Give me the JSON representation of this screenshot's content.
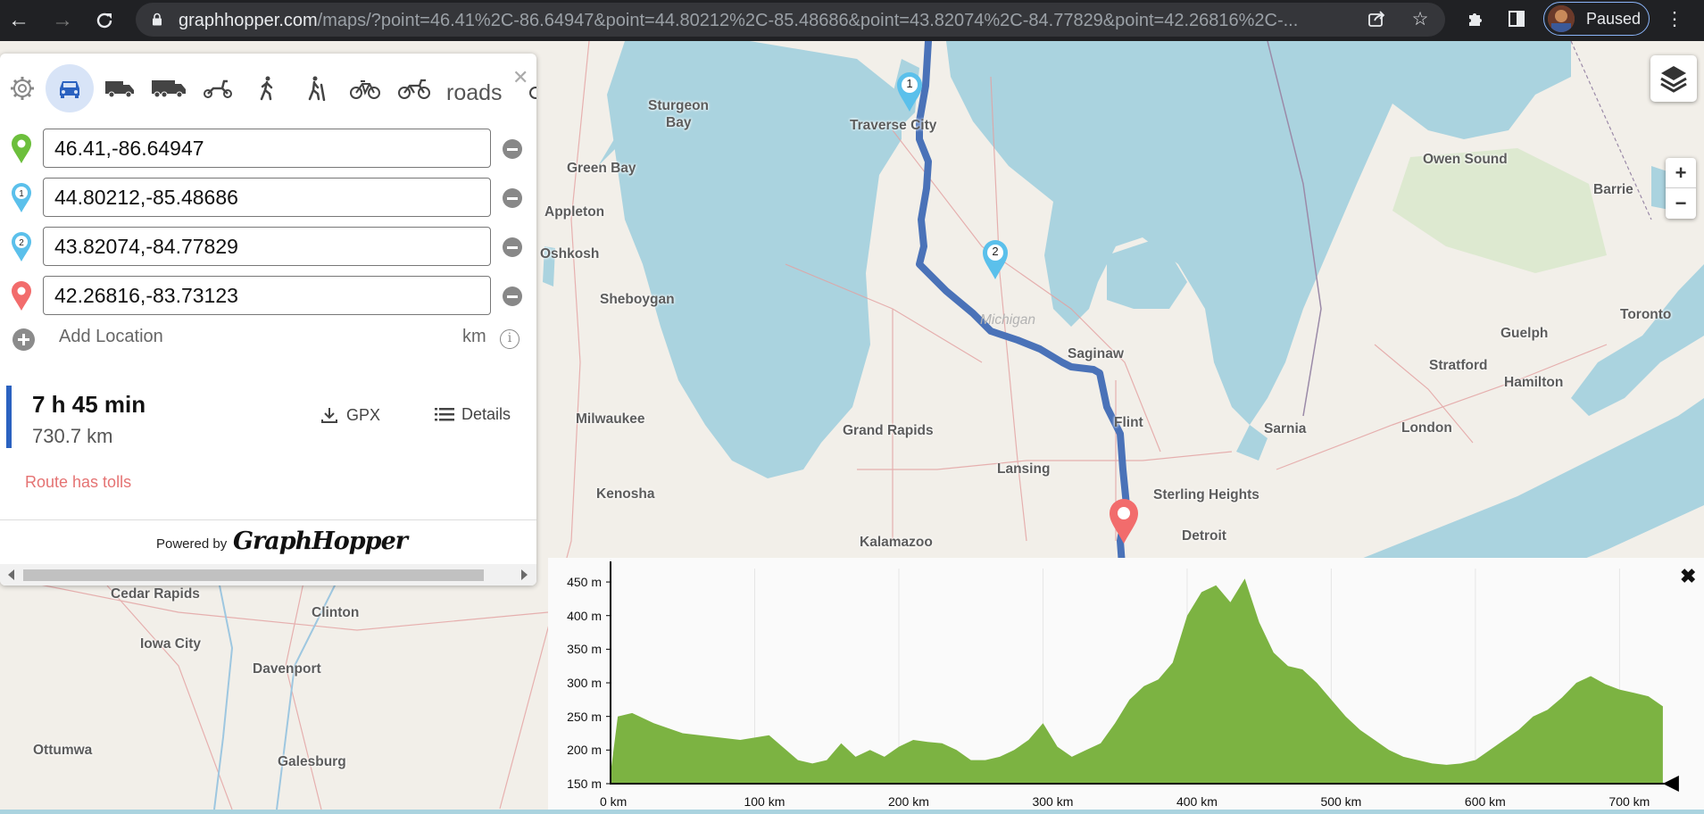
{
  "browser": {
    "url_host": "graphhopper.com",
    "url_rest": "/maps/?point=46.41%2C-86.64947&point=44.80212%2C-85.48686&point=43.82074%2C-84.77829&point=42.26816%2C-...",
    "profile_status": "Paused"
  },
  "panel": {
    "profiles_text": "roads",
    "waypoints": [
      {
        "value": "46.41,-86.64947",
        "marker": "start"
      },
      {
        "value": "44.80212,-85.48686",
        "marker": "1"
      },
      {
        "value": "43.82074,-84.77829",
        "marker": "2"
      },
      {
        "value": "42.26816,-83.73123",
        "marker": "end"
      }
    ],
    "add_location": "Add Location",
    "units": "km",
    "route": {
      "time": "7 h 45 min",
      "distance": "730.7 km",
      "gpx_label": "GPX",
      "details_label": "Details",
      "warning": "Route has tolls"
    },
    "powered_by": "Powered by",
    "brand": "GraphHopper"
  },
  "map": {
    "cities": [
      {
        "name": "Sturgeon"
      },
      {
        "name": "Bay"
      },
      {
        "name": "Traverse City"
      },
      {
        "name": "Green Bay"
      },
      {
        "name": "Appleton"
      },
      {
        "name": "Oshkosh"
      },
      {
        "name": "Sheboygan"
      },
      {
        "name": "Michigan"
      },
      {
        "name": "Saginaw"
      },
      {
        "name": "Milwaukee"
      },
      {
        "name": "Grand Rapids"
      },
      {
        "name": "Flint"
      },
      {
        "name": "Lansing"
      },
      {
        "name": "Kenosha"
      },
      {
        "name": "Sterling Heights"
      },
      {
        "name": "Detroit"
      },
      {
        "name": "Kalamazoo"
      },
      {
        "name": "Owen Sound"
      },
      {
        "name": "Barrie"
      },
      {
        "name": "Toronto"
      },
      {
        "name": "Guelph"
      },
      {
        "name": "Stratford"
      },
      {
        "name": "Hamilton"
      },
      {
        "name": "London"
      },
      {
        "name": "Sarnia"
      },
      {
        "name": "Cedar Rapids"
      },
      {
        "name": "Clinton"
      },
      {
        "name": "Iowa City"
      },
      {
        "name": "Davenport"
      },
      {
        "name": "Ottumwa"
      },
      {
        "name": "Galesburg"
      }
    ],
    "zoom_in": "+",
    "zoom_out": "−",
    "waypoint_labels": [
      "1",
      "2"
    ]
  },
  "elevation": {
    "close_label": "✖",
    "y_ticks": [
      "450 m",
      "400 m",
      "350 m",
      "300 m",
      "250 m",
      "200 m",
      "150 m"
    ],
    "x_ticks": [
      "0 km",
      "100 km",
      "200 km",
      "300 km",
      "400 km",
      "500 km",
      "600 km",
      "700 km"
    ],
    "fill_color": "#7cb342",
    "chart_data": {
      "type": "area",
      "xlabel": "",
      "ylabel": "",
      "xlim": [
        0,
        730.7
      ],
      "ylim": [
        150,
        470
      ],
      "x": [
        0,
        5,
        15,
        30,
        50,
        70,
        90,
        110,
        130,
        140,
        150,
        160,
        170,
        180,
        190,
        200,
        210,
        220,
        230,
        240,
        250,
        260,
        270,
        280,
        290,
        300,
        310,
        320,
        330,
        340,
        350,
        360,
        370,
        380,
        390,
        400,
        410,
        420,
        430,
        440,
        450,
        460,
        470,
        480,
        490,
        500,
        510,
        520,
        530,
        540,
        550,
        560,
        570,
        580,
        590,
        600,
        610,
        620,
        630,
        640,
        650,
        660,
        670,
        680,
        690,
        700,
        710,
        720,
        730
      ],
      "y": [
        165,
        250,
        255,
        240,
        225,
        220,
        215,
        222,
        185,
        180,
        185,
        210,
        190,
        200,
        190,
        205,
        215,
        212,
        210,
        200,
        185,
        185,
        190,
        200,
        215,
        240,
        205,
        190,
        200,
        210,
        240,
        275,
        295,
        305,
        330,
        400,
        435,
        445,
        420,
        455,
        390,
        345,
        325,
        320,
        300,
        275,
        250,
        230,
        215,
        200,
        190,
        185,
        180,
        178,
        180,
        185,
        200,
        215,
        230,
        250,
        260,
        278,
        300,
        310,
        298,
        290,
        285,
        280,
        265
      ]
    }
  }
}
